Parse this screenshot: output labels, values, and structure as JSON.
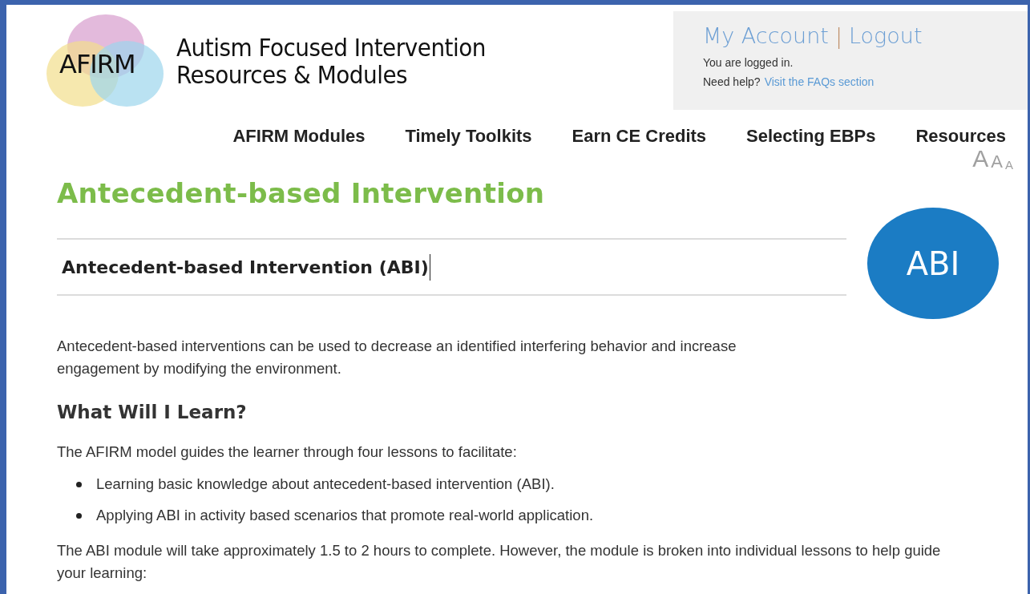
{
  "logo": {
    "mark": "AFIRM",
    "title_lines": [
      "Autism Focused Intervention",
      "Resources & Modules"
    ]
  },
  "account": {
    "links": [
      "My Account",
      "Logout"
    ],
    "separator": "|",
    "status": "You are logged in.",
    "help_prefix": "Need help?",
    "help_link": "Visit the FAQs section"
  },
  "nav": [
    "AFIRM Modules",
    "Timely Toolkits",
    "Earn CE Credits",
    "Selecting EBPs",
    "Resources"
  ],
  "text_size_buttons": [
    "A",
    "A",
    "A"
  ],
  "page_title": "Antecedent-based Intervention",
  "module_title": "Antecedent-based Intervention (ABI)",
  "badge": "ABI",
  "intro": "Antecedent-based interventions can be used to decrease an identified interfering behavior and increase engagement by modifying the environment.",
  "section_heading": "What Will I Learn?",
  "lead": "The AFIRM model guides the learner through four lessons to facilitate:",
  "bullets": [
    "Learning basic knowledge about antecedent-based intervention (ABI).",
    "Applying ABI in activity based scenarios that promote real-world application."
  ],
  "closing": "The ABI module will take approximately 1.5 to 2 hours to complete. However, the module is broken into individual lessons to help guide your learning:"
}
